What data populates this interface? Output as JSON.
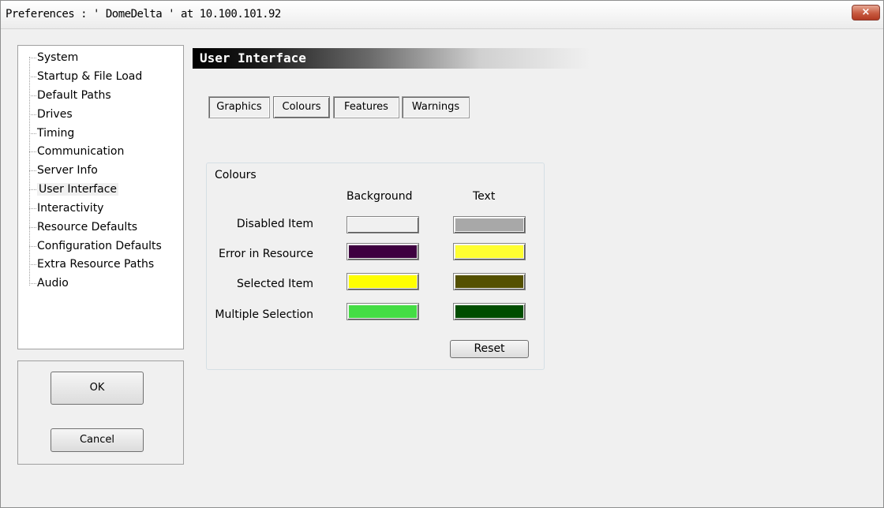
{
  "window": {
    "title": "Preferences  :  ' DomeDelta ' at 10.100.101.92",
    "close_label": "×"
  },
  "tree": {
    "items": [
      {
        "label": "System"
      },
      {
        "label": "Startup & File Load"
      },
      {
        "label": "Default Paths"
      },
      {
        "label": "Drives"
      },
      {
        "label": "Timing"
      },
      {
        "label": "Communication"
      },
      {
        "label": "Server Info"
      },
      {
        "label": "User Interface",
        "selected": true
      },
      {
        "label": "Interactivity"
      },
      {
        "label": "Resource Defaults"
      },
      {
        "label": "Configuration Defaults"
      },
      {
        "label": "Extra Resource Paths"
      },
      {
        "label": "Audio"
      }
    ]
  },
  "buttons": {
    "ok": "OK",
    "cancel": "Cancel"
  },
  "section": {
    "title": "User Interface"
  },
  "tabs": [
    {
      "label": "Graphics"
    },
    {
      "label": "Colours",
      "active": true
    },
    {
      "label": "Features"
    },
    {
      "label": "Warnings"
    }
  ],
  "colours": {
    "group_title": "Colours",
    "col_background": "Background",
    "col_text": "Text",
    "rows": [
      {
        "label": "Disabled Item",
        "background": "#f0f0f0",
        "text": "#a8a8a8"
      },
      {
        "label": "Error in Resource",
        "background": "#3e0040",
        "text": "#ffff30"
      },
      {
        "label": "Selected Item",
        "background": "#ffff00",
        "text": "#545000"
      },
      {
        "label": "Multiple Selection",
        "background": "#44dd44",
        "text": "#004d00"
      }
    ],
    "reset_label": "Reset"
  }
}
